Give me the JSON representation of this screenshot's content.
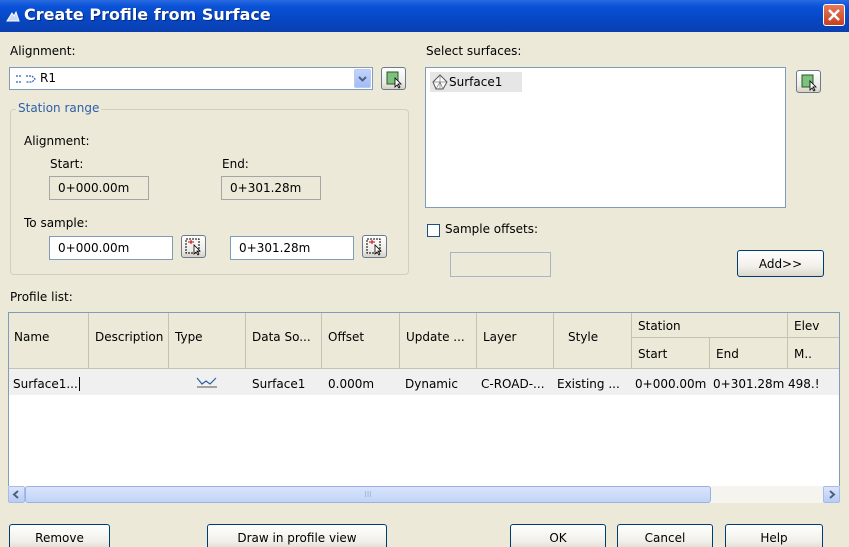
{
  "window": {
    "title": "Create Profile from Surface"
  },
  "alignment": {
    "label": "Alignment:",
    "value": "R1"
  },
  "station_range": {
    "group_label": "Station range",
    "alignment_label": "Alignment:",
    "start_label": "Start:",
    "end_label": "End:",
    "start_value": "0+000.00m",
    "end_value": "0+301.28m",
    "to_sample_label": "To sample:",
    "sample_start": "0+000.00m",
    "sample_end": "0+301.28m"
  },
  "surfaces": {
    "label": "Select surfaces:",
    "items": [
      "Surface1"
    ],
    "sample_offsets_label": "Sample offsets:",
    "add_label": "Add>>"
  },
  "profile_list": {
    "label": "Profile list:",
    "headers": {
      "name": "Name",
      "description": "Description",
      "type": "Type",
      "data_source": "Data So...",
      "offset": "Offset",
      "update": "Update ...",
      "layer": "Layer",
      "style": "Style",
      "station": "Station",
      "start": "Start",
      "end": "End",
      "elev": "Elev",
      "min": "M.."
    },
    "rows": [
      {
        "name": "Surface1...",
        "description": "",
        "data_source": "Surface1",
        "offset": "0.000m",
        "update": "Dynamic",
        "layer": "C-ROAD-...",
        "style": "Existing ...",
        "start": "0+000.00m",
        "end": "0+301.28m",
        "elev": "498.!"
      }
    ],
    "scroll_thumb_label": "III"
  },
  "buttons": {
    "remove": "Remove",
    "draw": "Draw in profile view",
    "ok": "OK",
    "cancel": "Cancel",
    "help": "Help"
  }
}
